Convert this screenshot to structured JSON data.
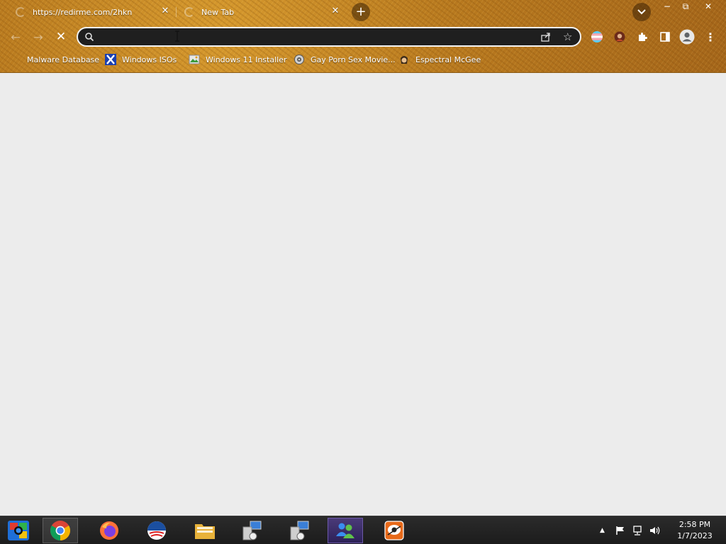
{
  "browser": {
    "tabs": [
      {
        "title": "https://redirme.com/2hkn",
        "loading": true
      },
      {
        "title": "New Tab",
        "loading": true
      }
    ],
    "new_tab_label": "+",
    "window_controls": {
      "minimize": "−",
      "maximize": "⧉",
      "close": "✕"
    },
    "omnibox": {
      "value": "",
      "placeholder": ""
    },
    "bookmarks": [
      {
        "label": "Malware Database",
        "icon": "malware-database-icon"
      },
      {
        "label": "Windows ISOs",
        "icon": "x-logo-icon"
      },
      {
        "label": "Windows 11 Installer",
        "icon": "installer-image-icon"
      },
      {
        "label": "Gay Porn Sex Movie...",
        "icon": "gear-badge-icon"
      },
      {
        "label": "Espectral McGee",
        "icon": "character-icon"
      }
    ]
  },
  "taskbar": {
    "items": [
      {
        "name": "start-button",
        "icon": "windows-orb-icon"
      },
      {
        "name": "chrome",
        "icon": "chrome-icon"
      },
      {
        "name": "firefox",
        "icon": "firefox-icon"
      },
      {
        "name": "obama",
        "icon": "obama-logo-icon"
      },
      {
        "name": "file-explorer",
        "icon": "folder-icon"
      },
      {
        "name": "network-app-1",
        "icon": "network-computer-icon"
      },
      {
        "name": "network-app-2",
        "icon": "network-computer-icon"
      },
      {
        "name": "msn-messenger",
        "icon": "messenger-icon"
      },
      {
        "name": "custom-app",
        "icon": "app-face-icon"
      }
    ],
    "clock": {
      "time": "2:58 PM",
      "date": "1/7/2023"
    }
  },
  "colors": {
    "theme_tan": "#b97a1f",
    "page_bg": "#ececec",
    "omnibox_bg": "#1f1f1f",
    "taskbar_bg": "#1c1c1c"
  }
}
